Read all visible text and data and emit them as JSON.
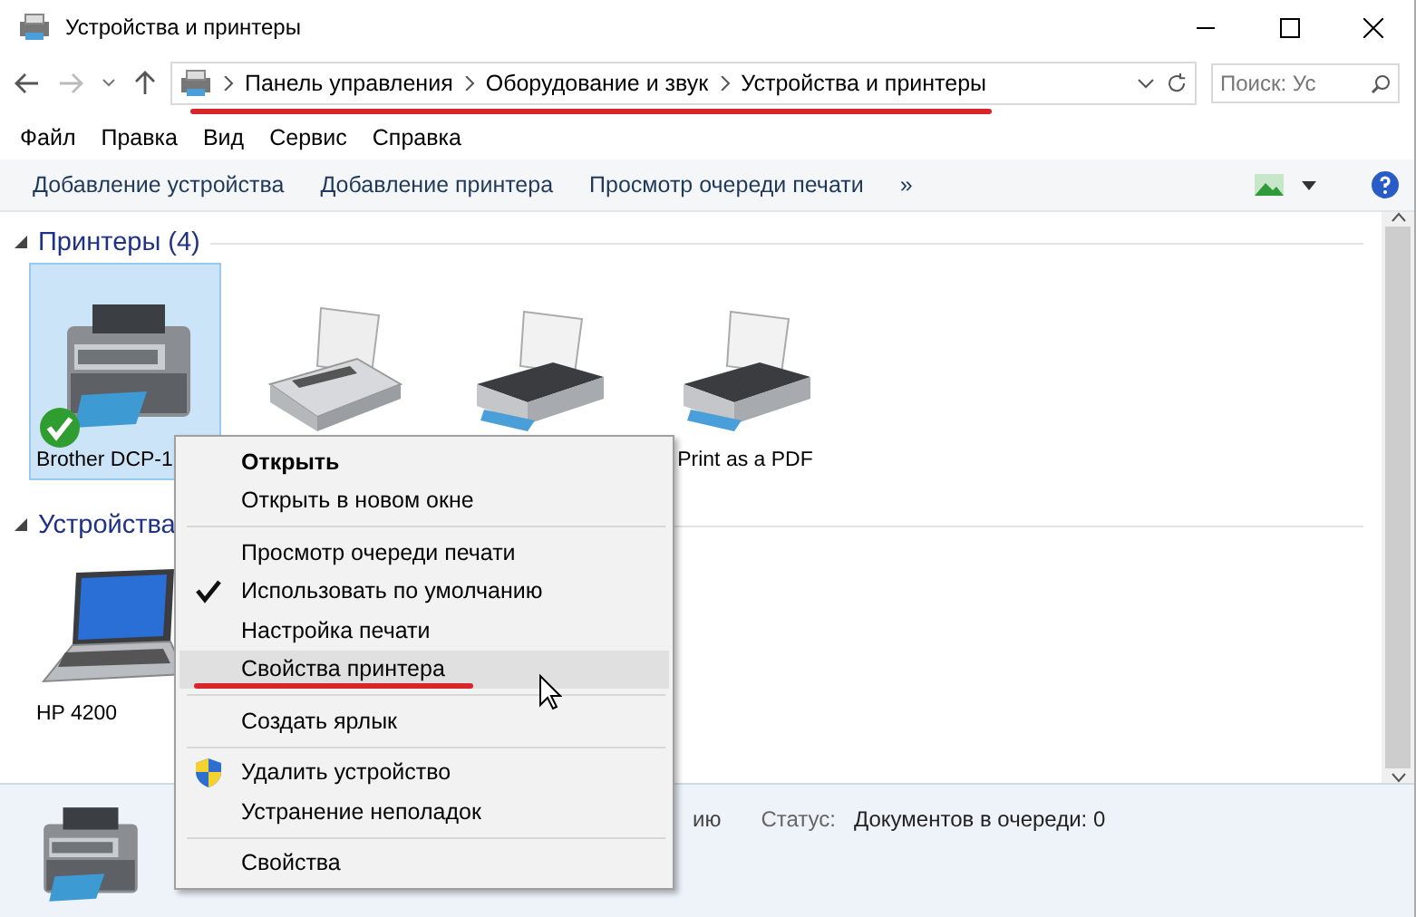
{
  "window": {
    "title": "Устройства и принтеры"
  },
  "address": {
    "crumbs": [
      "Панель управления",
      "Оборудование и звук",
      "Устройства и принтеры"
    ],
    "underlined": true,
    "search_placeholder": "Поиск: Ус"
  },
  "menu": [
    "Файл",
    "Правка",
    "Вид",
    "Сервис",
    "Справка"
  ],
  "toolbar": [
    "Добавление устройства",
    "Добавление принтера",
    "Просмотр очереди печати",
    "»"
  ],
  "groups": [
    {
      "title": "Принтеры (4)",
      "expanded": true,
      "devices": [
        {
          "kind": "mfp",
          "label": "Brother DCP-1",
          "selected": true,
          "default": true
        },
        {
          "kind": "fax",
          "selected": false,
          "default": false
        },
        {
          "kind": "printer",
          "selected": false,
          "default": false
        },
        {
          "kind": "printer",
          "label": "Print as a PDF",
          "selected": false,
          "default": false
        }
      ]
    },
    {
      "title": "Устройства",
      "expanded": true,
      "devices": [
        {
          "kind": "laptop",
          "label": "HP 4200",
          "selected": false,
          "default": false
        }
      ]
    }
  ],
  "details": {
    "fragment": "ию",
    "status_label": "Статус:",
    "status_value": "Документов в очереди: 0"
  },
  "context_menu": {
    "groups": [
      [
        {
          "label": "Открыть",
          "bold": true,
          "checked": false,
          "selected": false,
          "underlined": false
        },
        {
          "label": "Открыть в новом окне",
          "bold": false,
          "checked": false,
          "selected": false,
          "underlined": false
        }
      ],
      [
        {
          "label": "Просмотр очереди печати",
          "bold": false,
          "checked": false,
          "selected": false,
          "underlined": false
        },
        {
          "label": "Использовать по умолчанию",
          "bold": false,
          "checked": true,
          "selected": false,
          "underlined": false
        },
        {
          "label": "Настройка печати",
          "bold": false,
          "checked": false,
          "selected": false,
          "underlined": false
        },
        {
          "label": "Свойства принтера",
          "bold": false,
          "checked": false,
          "selected": true,
          "underlined": true
        }
      ],
      [
        {
          "label": "Создать ярлык",
          "bold": false,
          "checked": false,
          "selected": false,
          "underlined": false
        }
      ],
      [
        {
          "label": "Удалить устройство",
          "kind": "shield",
          "bold": false,
          "checked": false,
          "selected": false,
          "underlined": false
        },
        {
          "label": "Устранение неполадок",
          "bold": false,
          "checked": false,
          "selected": false,
          "underlined": false
        }
      ],
      [
        {
          "label": "Свойства",
          "bold": false,
          "checked": false,
          "selected": false,
          "underlined": false
        }
      ]
    ]
  }
}
